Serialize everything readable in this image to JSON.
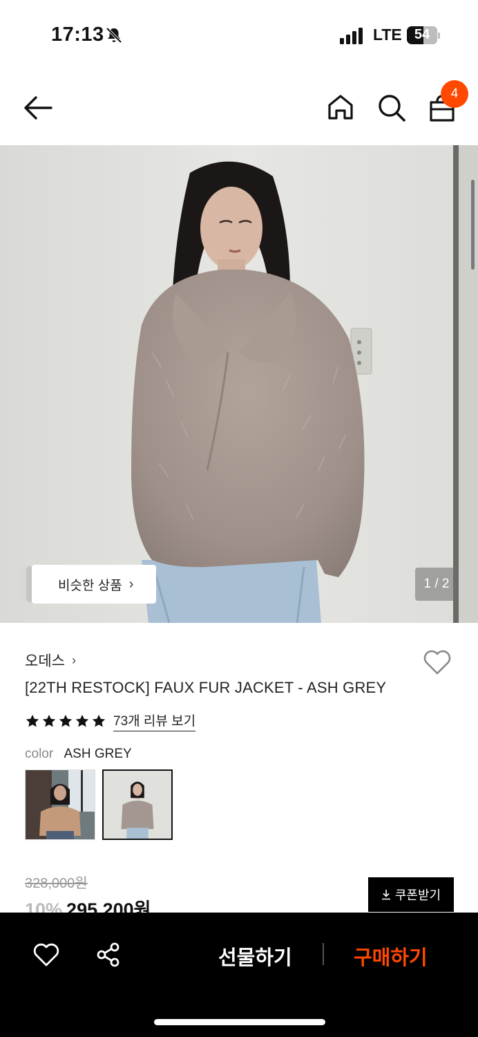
{
  "status_bar": {
    "time": "17:13",
    "network": "LTE",
    "battery": "54",
    "battery_level": 0.54
  },
  "nav": {
    "cart_badge": "4",
    "icons": [
      "arrow-left-icon",
      "home-icon",
      "search-icon",
      "shopping-bag-icon"
    ]
  },
  "gallery": {
    "similar_label": "비슷한 상품",
    "pager": "1 / 2"
  },
  "product": {
    "brand": "오데스",
    "title": "[22TH RESTOCK] FAUX FUR JACKET - ASH GREY",
    "rating_stars": 5,
    "review_link": "73개 리뷰 보기",
    "color_label": "color",
    "color_value": "ASH GREY",
    "original_price": "328,000원",
    "discount": "10%",
    "sale_price": "295,200원",
    "coupon_label": "쿠폰받기"
  },
  "bottom_bar": {
    "gift_label": "선물하기",
    "buy_label": "구매하기"
  },
  "colors": {
    "accent": "#ff4800",
    "bar_bg": "#000000"
  }
}
